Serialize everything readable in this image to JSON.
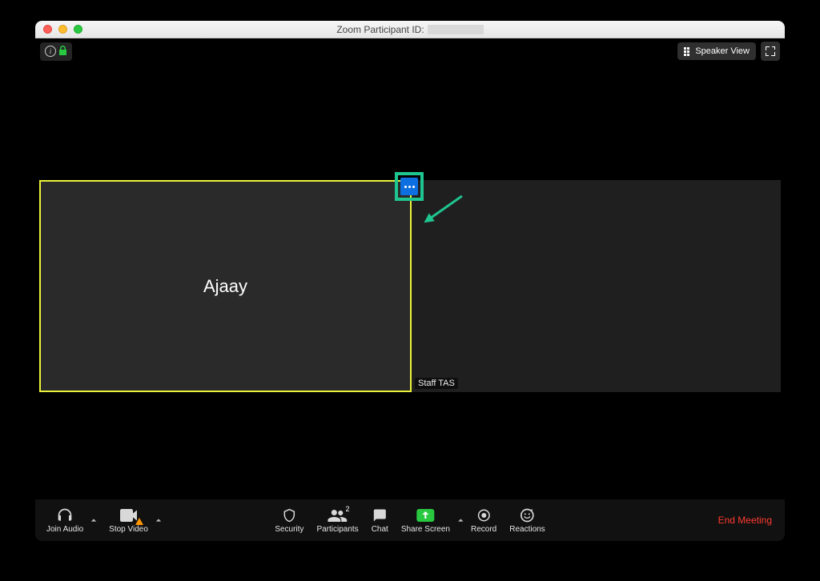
{
  "window": {
    "title_prefix": "Zoom Participant ID:"
  },
  "topbar": {
    "speaker_view_label": "Speaker View"
  },
  "participants": {
    "active_name": "Ajaay",
    "other_label": "Staff TAS"
  },
  "toolbar": {
    "join_audio": "Join Audio",
    "stop_video": "Stop Video",
    "security": "Security",
    "participants": "Participants",
    "participants_count": "2",
    "chat": "Chat",
    "share_screen": "Share Screen",
    "record": "Record",
    "reactions": "Reactions",
    "end_meeting": "End Meeting"
  }
}
